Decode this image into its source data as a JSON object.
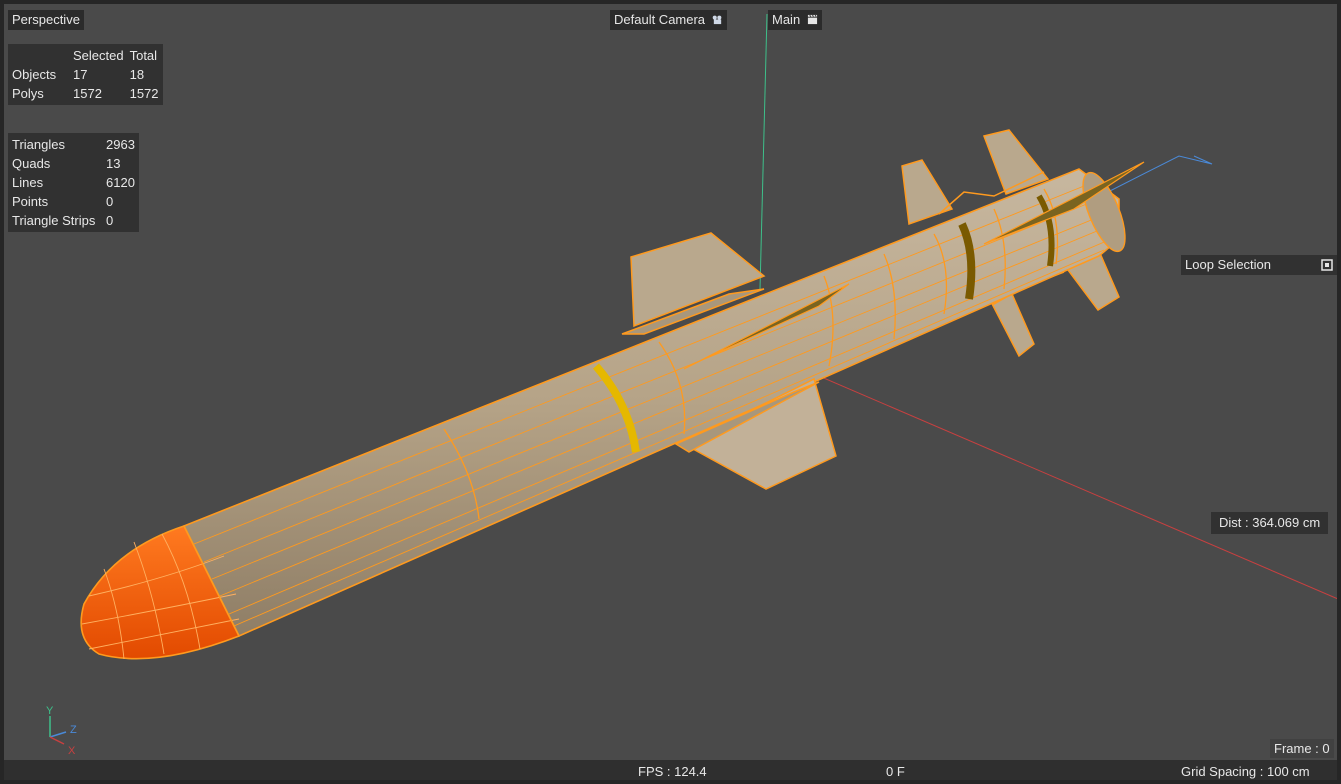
{
  "viewport": {
    "name": "Perspective",
    "camera": "Default Camera",
    "stage": "Main"
  },
  "stats_selection": {
    "headers": [
      "",
      "Selected",
      "Total"
    ],
    "rows": [
      {
        "label": "Objects",
        "selected": "17",
        "total": "18"
      },
      {
        "label": "Polys",
        "selected": "1572",
        "total": "1572"
      }
    ]
  },
  "stats_geometry": [
    {
      "label": "Triangles",
      "value": "2963"
    },
    {
      "label": "Quads",
      "value": "13"
    },
    {
      "label": "Lines",
      "value": "6120"
    },
    {
      "label": "Points",
      "value": "0"
    },
    {
      "label": "Triangle Strips",
      "value": "0"
    }
  ],
  "tool": {
    "label": "Loop Selection",
    "icon": "loop-selection-icon"
  },
  "dist_readout": "Dist : 364.069 cm",
  "status": {
    "fps": "FPS : 124.4",
    "frame_short": "0 F",
    "frame": "Frame : 0",
    "grid": "Grid Spacing : 100 cm"
  },
  "axis_labels": {
    "y": "Y",
    "z": "Z",
    "x": "X"
  },
  "colors": {
    "viewport_bg": "#4a4a4a",
    "selection": "#ff9a1e",
    "nose": "#ff5a00",
    "body": "#b3a18a",
    "axis_x": "#c84040",
    "axis_y": "#3ec08a",
    "axis_z": "#4a8ad8"
  }
}
